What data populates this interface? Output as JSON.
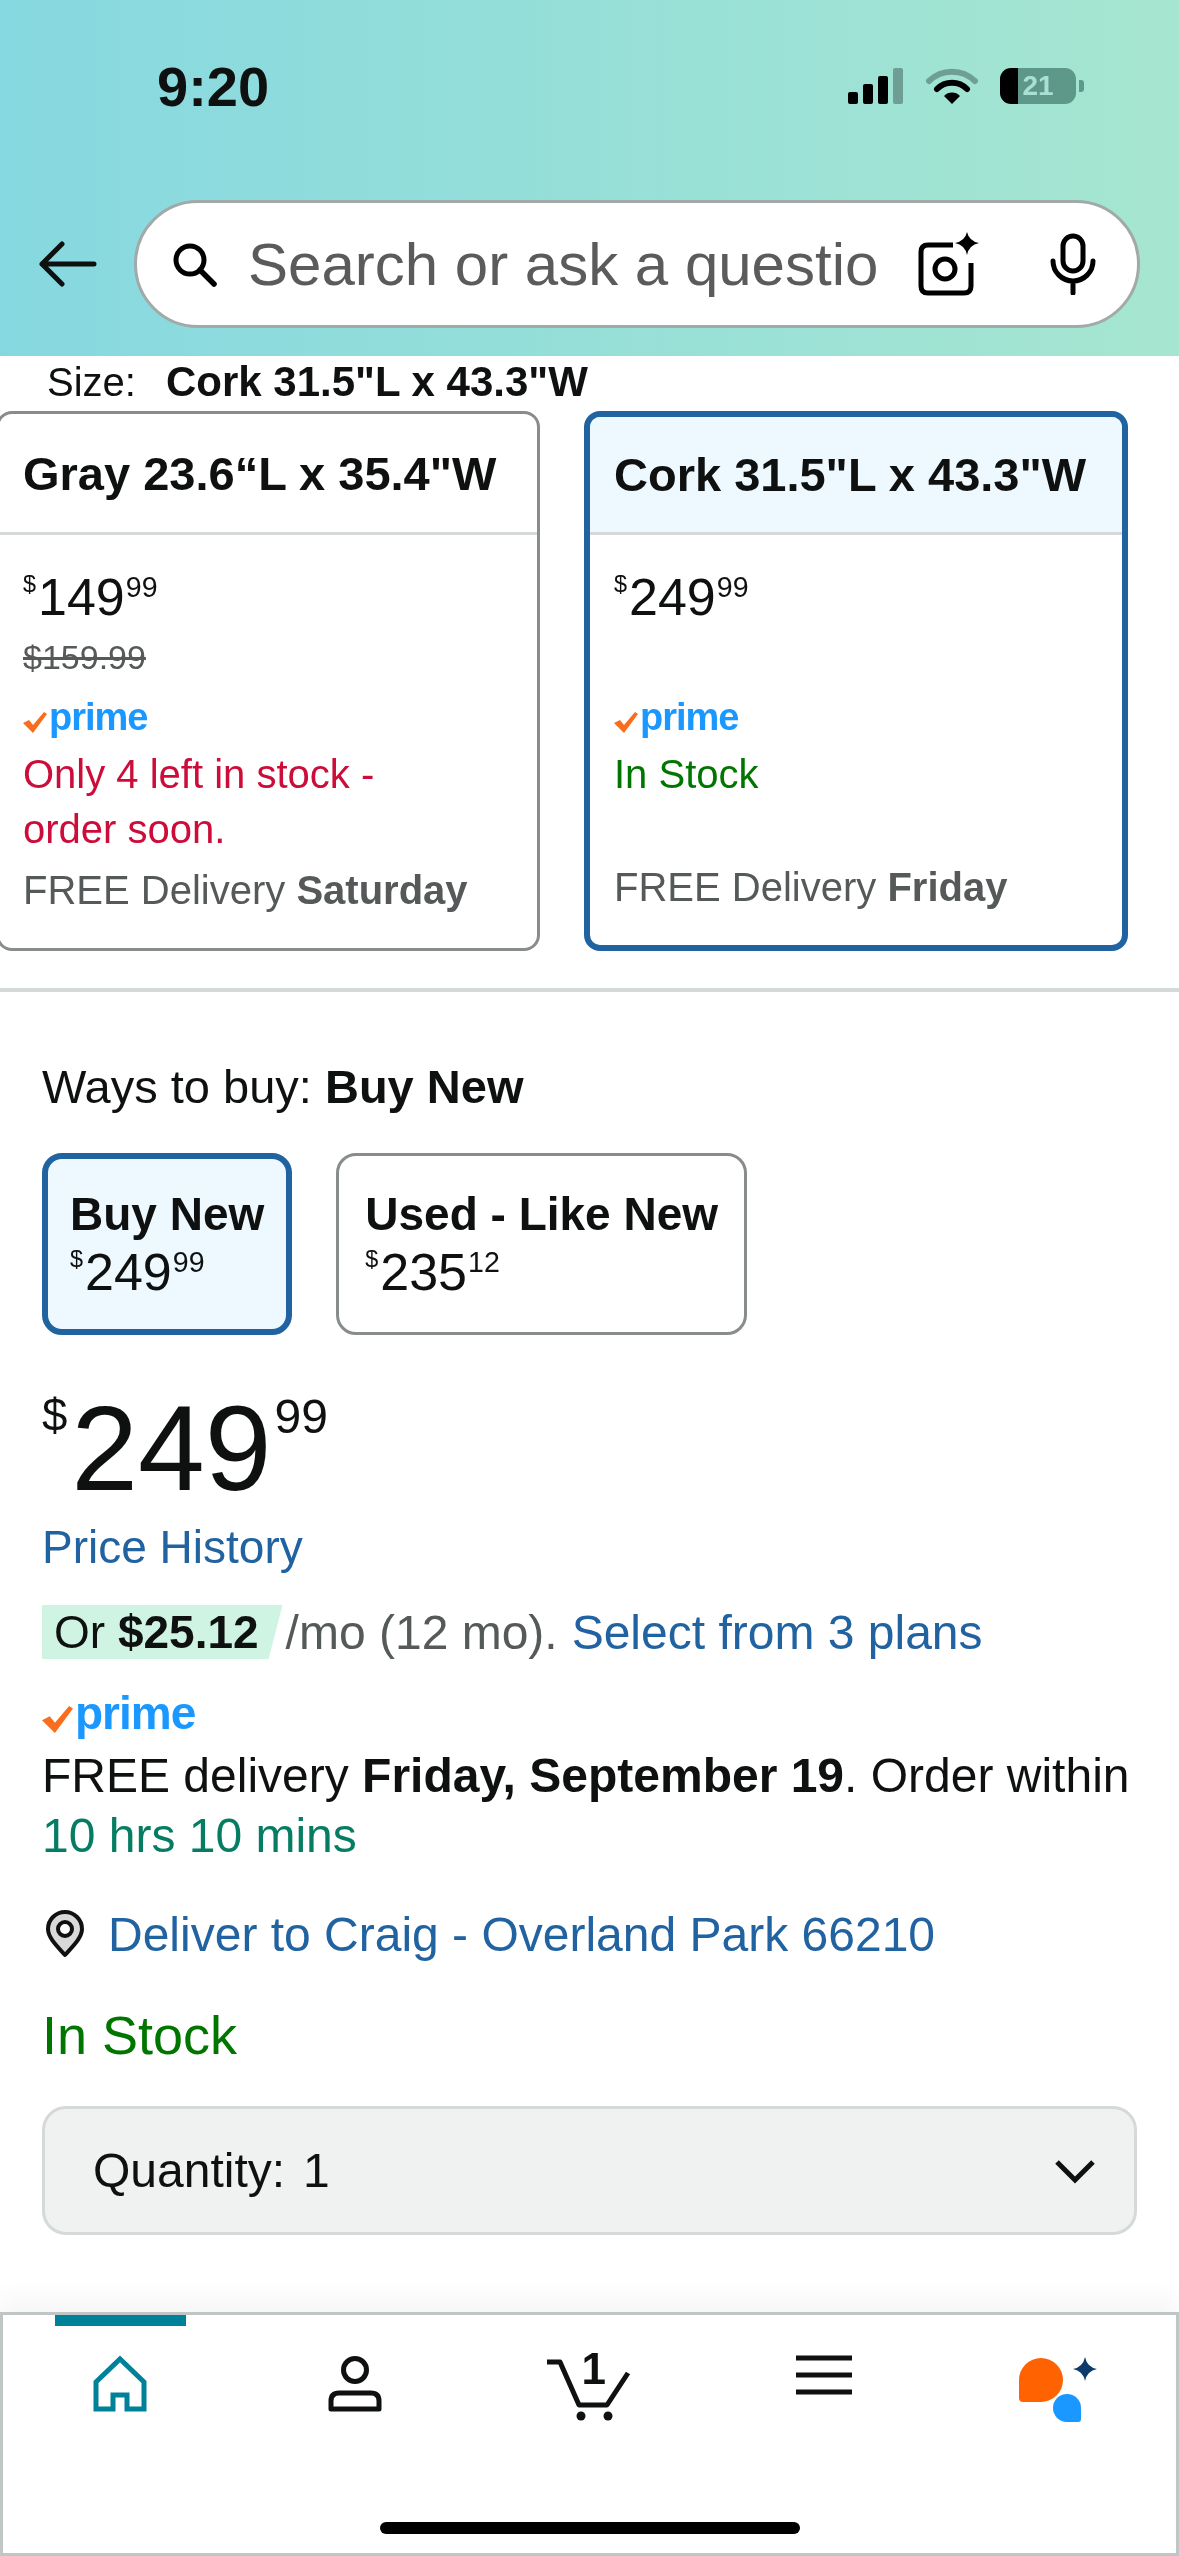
{
  "status_bar": {
    "time": "9:20",
    "battery": "21"
  },
  "header": {
    "search": {
      "placeholder": "Search or ask a questio"
    }
  },
  "size_selector": {
    "label": "Size:",
    "value": "Cork 31.5\"L x 43.3\"W",
    "options": [
      {
        "title": "Gray 23.6“L x 35.4\"W",
        "selected": false,
        "price": {
          "currency": "$",
          "whole": "149",
          "fraction": "99"
        },
        "list_price": "$159.99",
        "badge": "prime",
        "stock": {
          "kind": "low",
          "text": "Only 4 left in stock - order soon."
        },
        "delivery": "FREE Delivery **Saturday**"
      },
      {
        "title": "Cork 31.5\"L x 43.3\"W",
        "selected": true,
        "price": {
          "currency": "$",
          "whole": "249",
          "fraction": "99"
        },
        "badge": "prime",
        "stock": {
          "kind": "in_stock",
          "text": "In Stock"
        },
        "delivery": "FREE Delivery **Friday**"
      }
    ]
  },
  "ways_to_buy": {
    "heading": "Ways to buy: **Buy New**",
    "options": [
      {
        "title": "Buy New",
        "selected": true,
        "price": {
          "currency": "$",
          "whole": "249",
          "fraction": "99"
        }
      },
      {
        "title": "Used - Like New",
        "selected": false,
        "price": {
          "currency": "$",
          "whole": "235",
          "fraction": "12"
        }
      }
    ]
  },
  "price": {
    "currency": "$",
    "whole": "249",
    "fraction": "99"
  },
  "price_history_link": "Price History",
  "installment": {
    "offer": "Or **$25.12**",
    "terms": "/mo (12 mo).",
    "link": "Select from 3 plans"
  },
  "delivery": {
    "badge": "prime",
    "text": "FREE delivery **Friday, September 19**. Order within",
    "countdown": "10 hrs 10 mins"
  },
  "location": "Deliver to Craig - Overland Park 66210",
  "availability": {
    "kind": "in_stock",
    "text": "In Stock"
  },
  "quantity": {
    "label": "Quantity:",
    "value": "1"
  },
  "tab_bar": {
    "items": [
      {
        "kind": "home",
        "selected": true
      },
      {
        "kind": "account",
        "selected": false
      },
      {
        "kind": "cart",
        "selected": false,
        "count": "1"
      },
      {
        "kind": "menu",
        "selected": false
      },
      {
        "kind": "assistant",
        "selected": false
      }
    ]
  }
}
